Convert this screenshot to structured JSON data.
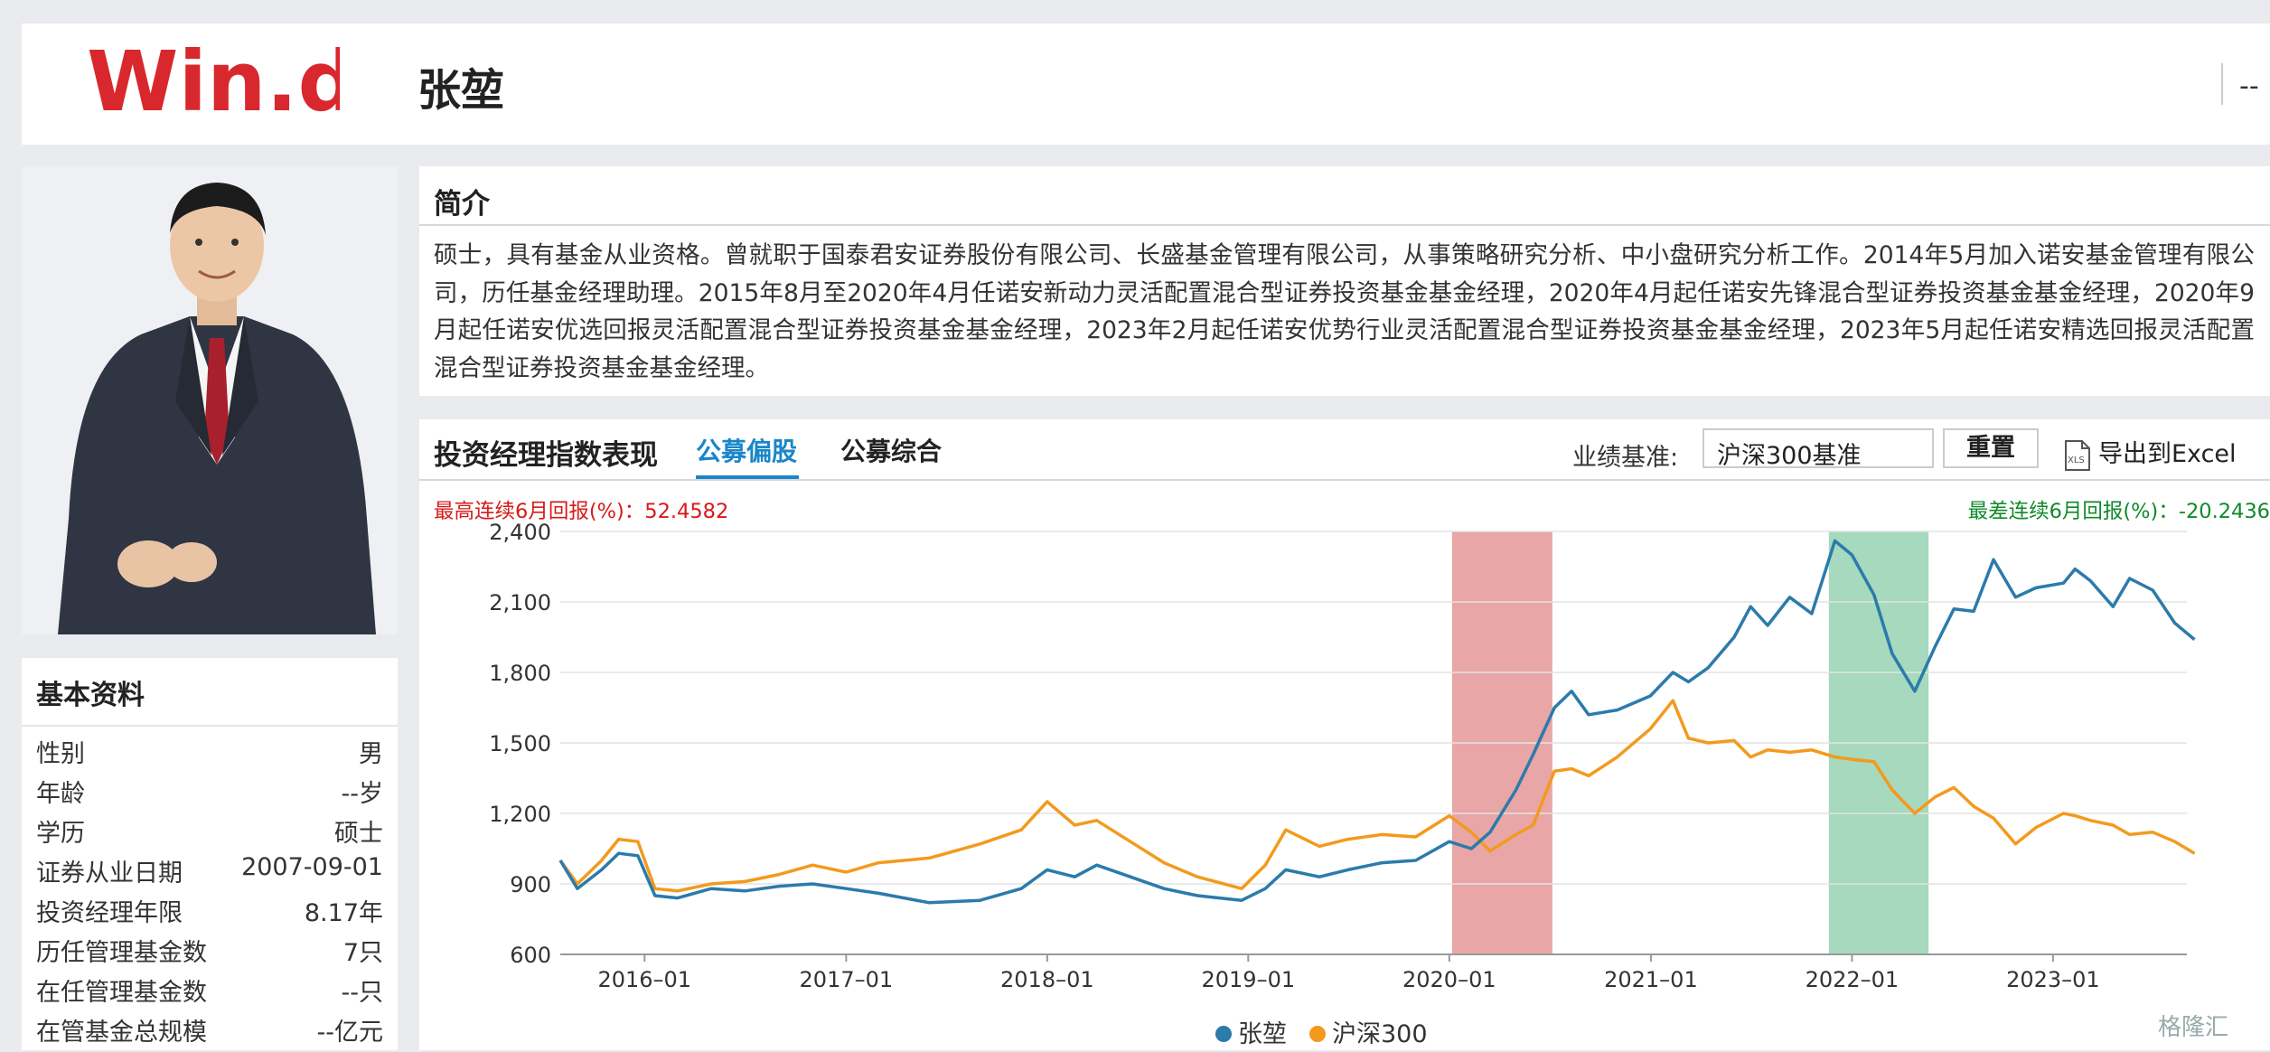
{
  "header": {
    "logo_text": "Win.d",
    "manager_name": "张堃",
    "right_text": "--"
  },
  "basic_info": {
    "title": "基本资料",
    "rows": [
      {
        "label": "性别",
        "value": "男"
      },
      {
        "label": "年龄",
        "value": "--岁"
      },
      {
        "label": "学历",
        "value": "硕士"
      },
      {
        "label": "证券从业日期",
        "value": "2007-09-01"
      },
      {
        "label": "投资经理年限",
        "value": "8.17年"
      },
      {
        "label": "历任管理基金数",
        "value": "7只"
      },
      {
        "label": "在任管理基金数",
        "value": "--只"
      },
      {
        "label": "在管基金总规模",
        "value": "--亿元"
      }
    ]
  },
  "intro": {
    "title": "简介",
    "text": "硕士，具有基金从业资格。曾就职于国泰君安证券股份有限公司、长盛基金管理有限公司，从事策略研究分析、中小盘研究分析工作。2014年5月加入诺安基金管理有限公司，历任基金经理助理。2015年8月至2020年4月任诺安新动力灵活配置混合型证券投资基金基金经理，2020年4月起任诺安先锋混合型证券投资基金基金经理，2020年9月起任诺安优选回报灵活配置混合型证券投资基金基金经理，2023年2月起任诺安优势行业灵活配置混合型证券投资基金基金经理，2023年5月起任诺安精选回报灵活配置混合型证券投资基金基金经理。"
  },
  "performance": {
    "title": "投资经理指数表现",
    "tabs": [
      {
        "label": "公募偏股",
        "active": true
      },
      {
        "label": "公募综合",
        "active": false
      }
    ],
    "benchmark_label": "业绩基准:",
    "benchmark_value": "沪深300基准",
    "reset_label": "重置",
    "export_label": "导出到Excel",
    "export_icon": "xls-icon",
    "max_return_text": "最高连续6月回报(%)：52.4582",
    "min_return_text": "最差连续6月回报(%)：-20.2436"
  },
  "chart_data": {
    "type": "line",
    "ylim": [
      600,
      2400
    ],
    "yticks": [
      600,
      900,
      1200,
      1500,
      1800,
      2100,
      2400
    ],
    "xlim": [
      "2015-08",
      "2023-09"
    ],
    "xticks": [
      "2016-01",
      "2017-01",
      "2018-01",
      "2019-01",
      "2020-01",
      "2021-01",
      "2022-01",
      "2023-01"
    ],
    "grid": true,
    "legend_position": "bottom",
    "highlights": [
      {
        "start": "2020-01-06",
        "end": "2020-07-06",
        "color": "#e8a6a6"
      },
      {
        "start": "2021-11-20",
        "end": "2022-05-20",
        "color": "#a6d9bd"
      }
    ],
    "series": [
      {
        "name": "张堃",
        "color": "#2b7bab",
        "points": [
          [
            "2015-08-01",
            1000
          ],
          [
            "2015-09-01",
            880
          ],
          [
            "2015-10-15",
            960
          ],
          [
            "2015-11-15",
            1030
          ],
          [
            "2015-12-20",
            1020
          ],
          [
            "2016-01-20",
            850
          ],
          [
            "2016-03-01",
            840
          ],
          [
            "2016-05-01",
            880
          ],
          [
            "2016-07-01",
            870
          ],
          [
            "2016-09-01",
            890
          ],
          [
            "2016-11-01",
            900
          ],
          [
            "2017-01-01",
            880
          ],
          [
            "2017-03-01",
            860
          ],
          [
            "2017-06-01",
            820
          ],
          [
            "2017-09-01",
            830
          ],
          [
            "2017-11-15",
            880
          ],
          [
            "2018-01-01",
            960
          ],
          [
            "2018-02-20",
            930
          ],
          [
            "2018-04-01",
            980
          ],
          [
            "2018-06-01",
            930
          ],
          [
            "2018-08-01",
            880
          ],
          [
            "2018-10-01",
            850
          ],
          [
            "2018-12-20",
            830
          ],
          [
            "2019-02-01",
            880
          ],
          [
            "2019-03-10",
            960
          ],
          [
            "2019-05-10",
            930
          ],
          [
            "2019-07-01",
            960
          ],
          [
            "2019-09-01",
            990
          ],
          [
            "2019-11-01",
            1000
          ],
          [
            "2020-01-01",
            1080
          ],
          [
            "2020-02-10",
            1050
          ],
          [
            "2020-03-15",
            1120
          ],
          [
            "2020-05-01",
            1300
          ],
          [
            "2020-06-01",
            1450
          ],
          [
            "2020-07-10",
            1650
          ],
          [
            "2020-08-10",
            1720
          ],
          [
            "2020-09-10",
            1620
          ],
          [
            "2020-11-01",
            1640
          ],
          [
            "2020-12-31",
            1700
          ],
          [
            "2021-02-10",
            1800
          ],
          [
            "2021-03-10",
            1760
          ],
          [
            "2021-04-15",
            1820
          ],
          [
            "2021-06-01",
            1950
          ],
          [
            "2021-07-01",
            2080
          ],
          [
            "2021-08-01",
            2000
          ],
          [
            "2021-09-10",
            2120
          ],
          [
            "2021-10-20",
            2050
          ],
          [
            "2021-12-01",
            2360
          ],
          [
            "2022-01-01",
            2300
          ],
          [
            "2022-02-10",
            2130
          ],
          [
            "2022-03-15",
            1880
          ],
          [
            "2022-04-25",
            1720
          ],
          [
            "2022-06-01",
            1910
          ],
          [
            "2022-07-05",
            2070
          ],
          [
            "2022-08-10",
            2060
          ],
          [
            "2022-09-15",
            2280
          ],
          [
            "2022-10-25",
            2120
          ],
          [
            "2022-12-01",
            2160
          ],
          [
            "2023-01-20",
            2180
          ],
          [
            "2023-02-10",
            2240
          ],
          [
            "2023-03-10",
            2190
          ],
          [
            "2023-04-20",
            2080
          ],
          [
            "2023-05-20",
            2200
          ],
          [
            "2023-07-01",
            2150
          ],
          [
            "2023-08-10",
            2010
          ],
          [
            "2023-09-15",
            1940
          ]
        ]
      },
      {
        "name": "沪深300",
        "color": "#f39a1e",
        "points": [
          [
            "2015-08-01",
            1000
          ],
          [
            "2015-09-01",
            900
          ],
          [
            "2015-10-15",
            1000
          ],
          [
            "2015-11-15",
            1090
          ],
          [
            "2015-12-20",
            1080
          ],
          [
            "2016-01-20",
            880
          ],
          [
            "2016-03-01",
            870
          ],
          [
            "2016-05-01",
            900
          ],
          [
            "2016-07-01",
            910
          ],
          [
            "2016-09-01",
            940
          ],
          [
            "2016-11-01",
            980
          ],
          [
            "2017-01-01",
            950
          ],
          [
            "2017-03-01",
            990
          ],
          [
            "2017-06-01",
            1010
          ],
          [
            "2017-09-01",
            1070
          ],
          [
            "2017-11-15",
            1130
          ],
          [
            "2018-01-01",
            1250
          ],
          [
            "2018-02-20",
            1150
          ],
          [
            "2018-04-01",
            1170
          ],
          [
            "2018-06-01",
            1080
          ],
          [
            "2018-08-01",
            990
          ],
          [
            "2018-10-01",
            930
          ],
          [
            "2018-12-20",
            880
          ],
          [
            "2019-02-01",
            980
          ],
          [
            "2019-03-10",
            1130
          ],
          [
            "2019-05-10",
            1060
          ],
          [
            "2019-07-01",
            1090
          ],
          [
            "2019-09-01",
            1110
          ],
          [
            "2019-11-01",
            1100
          ],
          [
            "2020-01-01",
            1190
          ],
          [
            "2020-02-10",
            1120
          ],
          [
            "2020-03-15",
            1040
          ],
          [
            "2020-05-01",
            1110
          ],
          [
            "2020-06-01",
            1150
          ],
          [
            "2020-07-10",
            1380
          ],
          [
            "2020-08-10",
            1390
          ],
          [
            "2020-09-10",
            1360
          ],
          [
            "2020-11-01",
            1440
          ],
          [
            "2020-12-31",
            1560
          ],
          [
            "2021-02-10",
            1680
          ],
          [
            "2021-03-10",
            1520
          ],
          [
            "2021-04-15",
            1500
          ],
          [
            "2021-06-01",
            1510
          ],
          [
            "2021-07-01",
            1440
          ],
          [
            "2021-08-01",
            1470
          ],
          [
            "2021-09-10",
            1460
          ],
          [
            "2021-10-20",
            1470
          ],
          [
            "2021-12-01",
            1440
          ],
          [
            "2022-01-01",
            1430
          ],
          [
            "2022-02-10",
            1420
          ],
          [
            "2022-03-15",
            1300
          ],
          [
            "2022-04-25",
            1200
          ],
          [
            "2022-06-01",
            1270
          ],
          [
            "2022-07-05",
            1310
          ],
          [
            "2022-08-10",
            1230
          ],
          [
            "2022-09-15",
            1180
          ],
          [
            "2022-10-25",
            1070
          ],
          [
            "2022-12-01",
            1140
          ],
          [
            "2023-01-20",
            1200
          ],
          [
            "2023-02-10",
            1190
          ],
          [
            "2023-03-10",
            1170
          ],
          [
            "2023-04-20",
            1150
          ],
          [
            "2023-05-20",
            1110
          ],
          [
            "2023-07-01",
            1120
          ],
          [
            "2023-08-10",
            1080
          ],
          [
            "2023-09-15",
            1030
          ]
        ]
      }
    ]
  },
  "watermark": "格隆汇"
}
